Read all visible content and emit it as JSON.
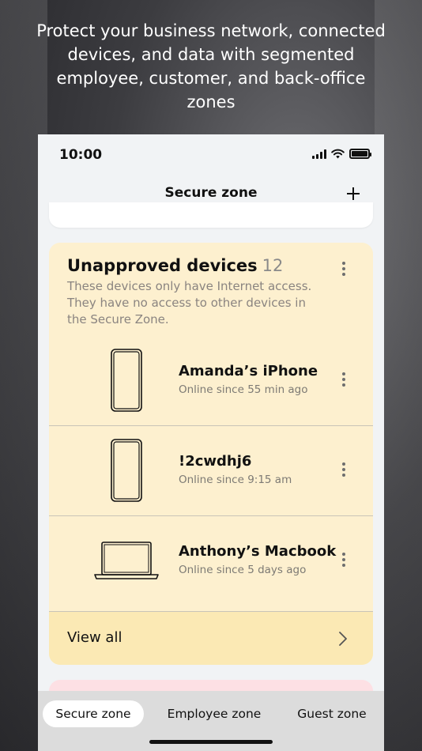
{
  "headline": "Protect your business network, connected devices, and data with segmented employee, customer, and back-office zones",
  "status_bar": {
    "time": "10:00"
  },
  "nav": {
    "title": "Secure zone",
    "add_icon": "plus-icon"
  },
  "unapproved": {
    "title": "Unapproved devices",
    "count": "12",
    "description": "These devices only have Internet access. They have no access to other devices in the Secure Zone.",
    "devices": [
      {
        "name": "Amanda’s iPhone",
        "status": "Online since 55 min ago",
        "icon": "smartphone-icon"
      },
      {
        "name": "!2cwdhj6",
        "status": "Online since 9:15 am",
        "icon": "smartphone-icon"
      },
      {
        "name": "Anthony’s Macbook",
        "status": "Online since 5 days ago",
        "icon": "laptop-icon"
      }
    ],
    "view_all_label": "View all"
  },
  "tabs": [
    {
      "label": "Secure zone",
      "active": true
    },
    {
      "label": "Employee zone",
      "active": false
    },
    {
      "label": "Guest zone",
      "active": false
    }
  ],
  "colors": {
    "card_bg": "#fdf0cf",
    "view_all_bg": "#fbe9b4",
    "next_card_bg": "#fde0e4",
    "tabbar_bg": "#dcdcdc"
  }
}
